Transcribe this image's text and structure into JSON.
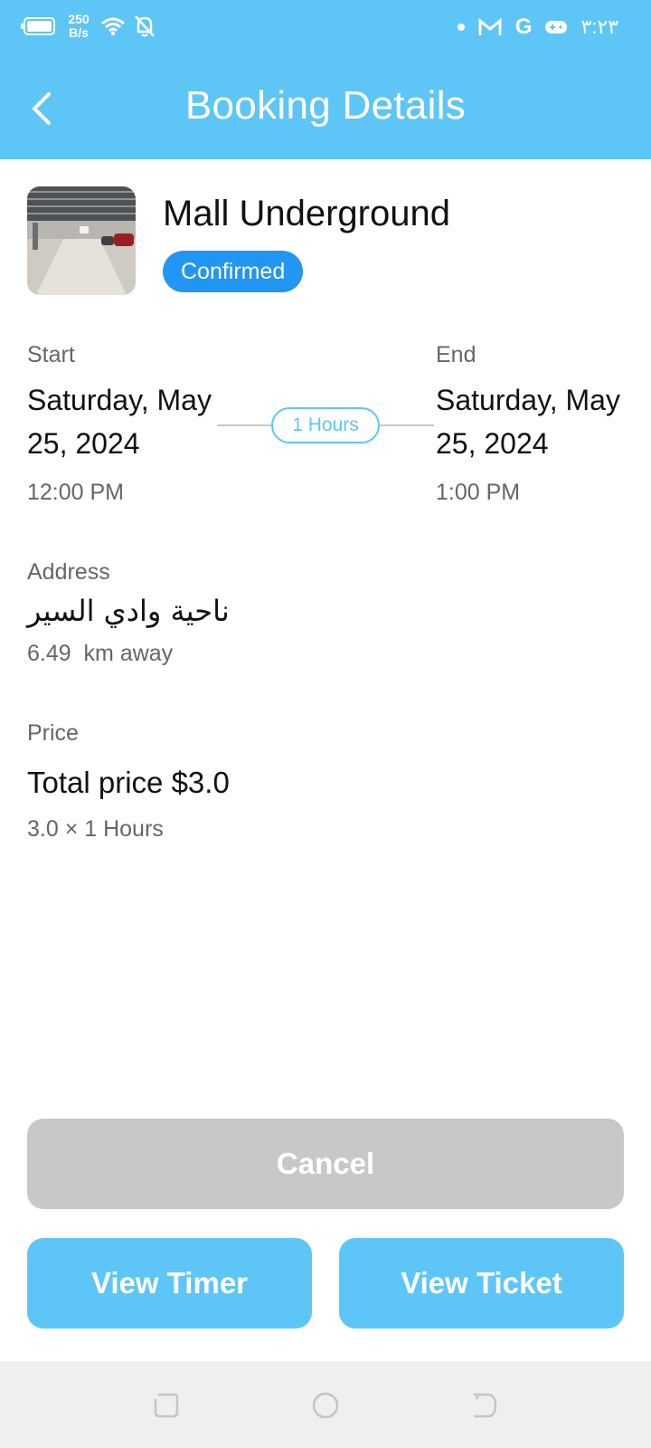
{
  "status_bar": {
    "net_speed": "250\nB/s",
    "time": "٣:٢٣",
    "icons": [
      "battery-icon",
      "wifi-icon",
      "bell-off-icon",
      "dot-icon",
      "gmail-icon",
      "google-icon",
      "gamepad-icon"
    ]
  },
  "header": {
    "title": "Booking Details",
    "back_icon": "chevron-left-icon"
  },
  "booking": {
    "place_name": "Mall Underground",
    "status": "Confirmed",
    "start_label": "Start",
    "start_date": "Saturday, May 25, 2024",
    "start_time": "12:00 PM",
    "duration": "1 Hours",
    "end_label": "End",
    "end_date": "Saturday, May 25, 2024",
    "end_time": "1:00 PM",
    "address_label": "Address",
    "address": "ناحية وادي السير",
    "distance": "6.49  km away",
    "price_label": "Price",
    "total_price": "Total price $3.0",
    "price_calc": "3.0 × 1 Hours"
  },
  "actions": {
    "cancel_label": "Cancel",
    "view_timer_label": "View Timer",
    "view_ticket_label": "View Ticket"
  },
  "nav": {
    "icons": [
      "recents-icon",
      "home-icon",
      "back-icon"
    ]
  },
  "colors": {
    "accent": "#5ec6f7",
    "badge": "#2196f3",
    "disabled": "#c8c8c8"
  }
}
